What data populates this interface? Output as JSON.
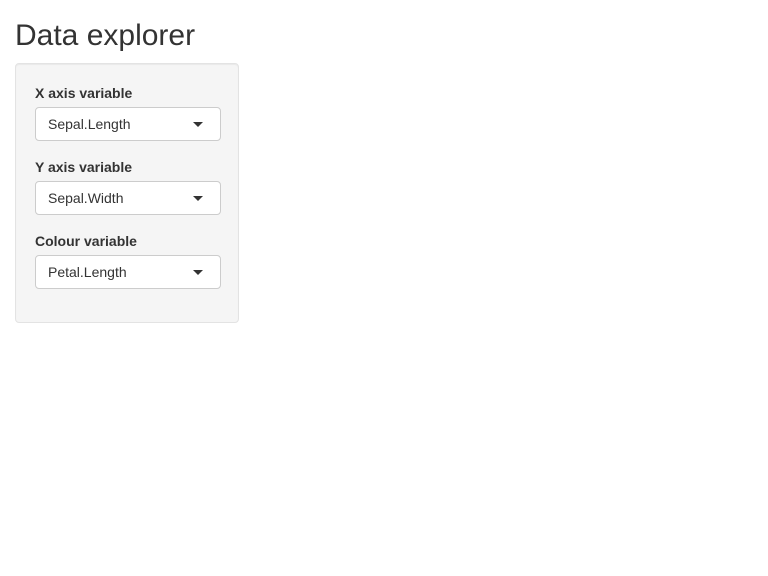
{
  "app": {
    "title": "Data explorer"
  },
  "sidebar": {
    "fields": [
      {
        "label": "X axis variable",
        "selected": "Sepal.Length"
      },
      {
        "label": "Y axis variable",
        "selected": "Sepal.Width"
      },
      {
        "label": "Colour variable",
        "selected": "Petal.Length"
      }
    ]
  },
  "icons": {
    "dropdown": "caret-down-icon"
  }
}
